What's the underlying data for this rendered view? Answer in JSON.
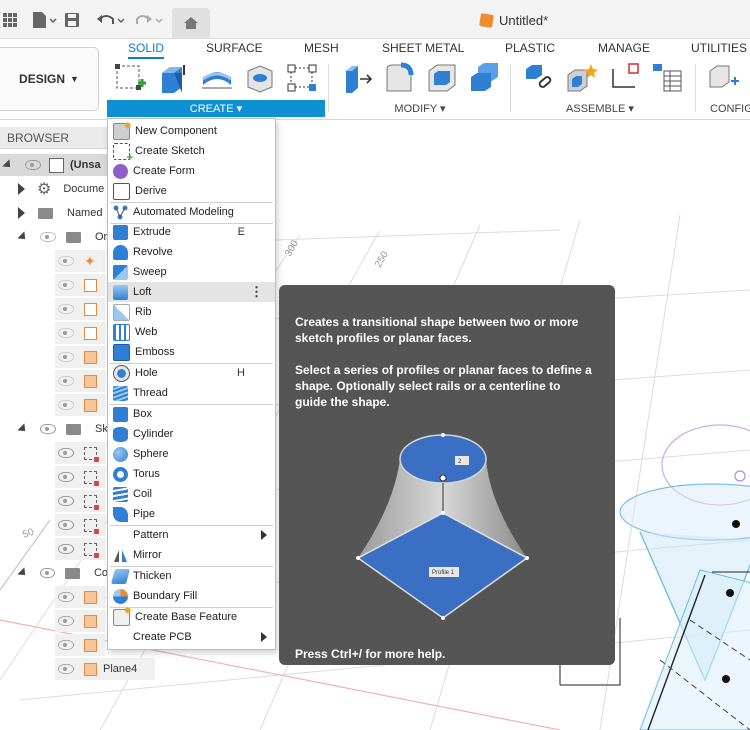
{
  "document": {
    "title": "Untitled*"
  },
  "ribbon": {
    "design_label": "DESIGN",
    "tabs": [
      "SOLID",
      "SURFACE",
      "MESH",
      "SHEET METAL",
      "PLASTIC",
      "MANAGE",
      "UTILITIES"
    ],
    "groups": [
      "CREATE ▾",
      "MODIFY ▾",
      "ASSEMBLE ▾",
      "CONFIG"
    ]
  },
  "browser": {
    "header": "BROWSER",
    "rows": [
      "(Unsa",
      "Docume",
      "Named",
      "Or",
      "Sk",
      "Co",
      "Plane4"
    ]
  },
  "menu": {
    "items": [
      {
        "label": "New Component",
        "shortcut": ""
      },
      {
        "label": "Create Sketch",
        "shortcut": ""
      },
      {
        "label": "Create Form",
        "shortcut": ""
      },
      {
        "label": "Derive",
        "shortcut": ""
      },
      {
        "label": "Automated Modeling",
        "shortcut": ""
      },
      {
        "label": "Extrude",
        "shortcut": "E"
      },
      {
        "label": "Revolve",
        "shortcut": ""
      },
      {
        "label": "Sweep",
        "shortcut": ""
      },
      {
        "label": "Loft",
        "shortcut": ""
      },
      {
        "label": "Rib",
        "shortcut": ""
      },
      {
        "label": "Web",
        "shortcut": ""
      },
      {
        "label": "Emboss",
        "shortcut": ""
      },
      {
        "label": "Hole",
        "shortcut": "H"
      },
      {
        "label": "Thread",
        "shortcut": ""
      },
      {
        "label": "Box",
        "shortcut": ""
      },
      {
        "label": "Cylinder",
        "shortcut": ""
      },
      {
        "label": "Sphere",
        "shortcut": ""
      },
      {
        "label": "Torus",
        "shortcut": ""
      },
      {
        "label": "Coil",
        "shortcut": ""
      },
      {
        "label": "Pipe",
        "shortcut": ""
      },
      {
        "label": "Pattern",
        "shortcut": ""
      },
      {
        "label": "Mirror",
        "shortcut": ""
      },
      {
        "label": "Thicken",
        "shortcut": ""
      },
      {
        "label": "Boundary Fill",
        "shortcut": ""
      },
      {
        "label": "Create Base Feature",
        "shortcut": ""
      },
      {
        "label": "Create PCB",
        "shortcut": ""
      }
    ]
  },
  "tooltip": {
    "line1": "Creates a transitional shape between two or more sketch profiles or planar faces.",
    "line2": "Select a series of profiles or planar faces to define a shape. Optionally select rails or a centerline to guide the shape.",
    "profile_label_top": "2",
    "profile_label_bottom": "Profile 1",
    "footer": "Press Ctrl+/ for more help."
  },
  "viewport": {
    "ruler_labels": [
      "250",
      "300",
      "50"
    ]
  },
  "colors": {
    "accent": "#0e90d2",
    "tooltip_bg": "#555555",
    "loft_face": "#3a6fc4"
  }
}
